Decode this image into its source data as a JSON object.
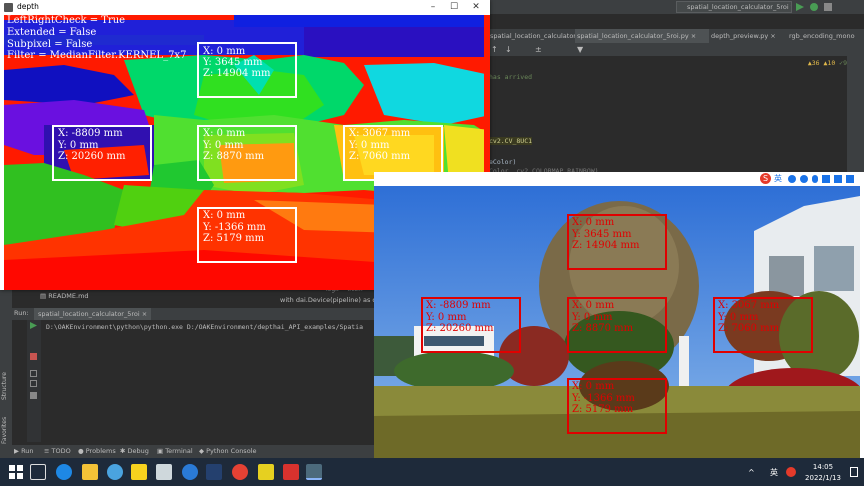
{
  "ide": {
    "tabs": [
      {
        "label": "spatial_location_calculator.py"
      },
      {
        "label": "spatial_location_calculator_5roi.py"
      },
      {
        "label": "depth_preview.py"
      },
      {
        "label": "rgb_encoding_mono"
      }
    ],
    "run_config": "spatial_location_calculator_5roi",
    "inspections": {
      "warnings": "▲36",
      "weak": "▲10",
      "typos": "✓9"
    },
    "editor_lines": [
      "has arrived",
      "cv2.CV_8UC1",
      "eColor)",
      "Color, cv2.COLORMAP_RAINBOW)"
    ],
    "code_snippet_1": "with dai.Device(pipeline) as de...",
    "code_snippet_2": "logx = init...",
    "project_file": "README.md",
    "run_label": "Run:",
    "run_tab": "spatial_location_calculator_5roi",
    "run_command": "D:\\OAKEnvironment\\python\\python.exe D:/OAKEnvironment/depthai_API_examples/Spatia",
    "side_labels": [
      "Structure",
      "Favorites"
    ],
    "bottom_tabs": [
      "Run",
      "TODO",
      "Problems",
      "Debug",
      "Terminal",
      "Python Console"
    ]
  },
  "depth_window": {
    "title": "depth",
    "overlay_lines": [
      "LeftRightCheck = True",
      "Extended = False",
      "Subpixel = False",
      "Filter = MedianFilter.KERNEL_7x7"
    ],
    "rois": [
      {
        "lines": [
          "X: 0 mm",
          "Y: 3645 mm",
          "Z: 14904 mm"
        ]
      },
      {
        "lines": [
          "X: -8809 mm",
          "Y: 0 mm",
          "Z: 20260 mm"
        ]
      },
      {
        "lines": [
          "X: 0 mm",
          "Y: 0 mm",
          "Z: 8870 mm"
        ]
      },
      {
        "lines": [
          "X: 3067 mm",
          "Y: 0 mm",
          "Z: 7060 mm"
        ]
      },
      {
        "lines": [
          "X: 0 mm",
          "Y: -1366 mm",
          "Z: 5179 mm"
        ]
      }
    ]
  },
  "rgb_window": {
    "rois": [
      {
        "lines": [
          "X: 0 mm",
          "Y: 3645 mm",
          "Z: 14904 mm"
        ]
      },
      {
        "lines": [
          "X: -8809 mm",
          "Y: 0 mm",
          "Z: 20260 mm"
        ]
      },
      {
        "lines": [
          "X: 0 mm",
          "Y: 0 mm",
          "Z: 8870 mm"
        ]
      },
      {
        "lines": [
          "X: 3067 mm",
          "Y: 0 mm",
          "Z: 7060 mm"
        ]
      },
      {
        "lines": [
          "X: 0 mm",
          "Y: -1366 mm",
          "Z: 5179 mm"
        ]
      }
    ]
  },
  "taskbar": {
    "time": "14:05",
    "date": "2022/1/13",
    "ime": "英"
  }
}
